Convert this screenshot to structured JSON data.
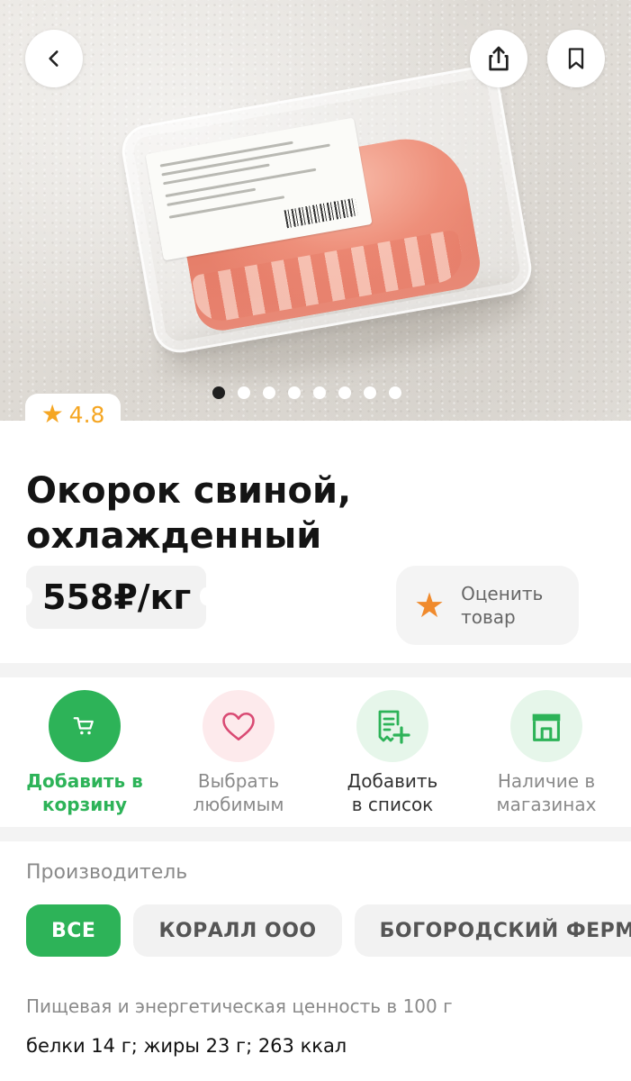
{
  "product": {
    "rating": "4.8",
    "title": "Окорок свиной, охлажденный",
    "price": "558₽/кг",
    "rate_button_label": "Оценить\nтовар"
  },
  "gallery": {
    "slides_count": 8,
    "active_index": 0
  },
  "header": {
    "back_icon": "chevron-left-icon",
    "share_icon": "share-icon",
    "bookmark_icon": "bookmark-icon"
  },
  "actions": [
    {
      "label": "Добавить в\nкорзину",
      "icon": "cart-icon"
    },
    {
      "label": "Выбрать\nлюбимым",
      "icon": "heart-icon"
    },
    {
      "label": "Добавить\nв список",
      "icon": "list-add-icon"
    },
    {
      "label": "Наличие в\nмагазинах",
      "icon": "store-icon"
    }
  ],
  "manufacturer": {
    "label": "Производитель",
    "chips": [
      {
        "label": "ВСЕ",
        "selected": true
      },
      {
        "label": "КОРАЛЛ ООО",
        "selected": false
      },
      {
        "label": "БОГОРОДСКИЙ ФЕРМЕР",
        "selected": false
      }
    ]
  },
  "nutrition": {
    "label": "Пищевая и энергетическая ценность в 100 г",
    "value": "белки 14 г; жиры 23 г; 263 ккал"
  },
  "colors": {
    "accent_green": "#2db358",
    "star_orange": "#f5a623",
    "heart_pink": "#d94a73"
  }
}
